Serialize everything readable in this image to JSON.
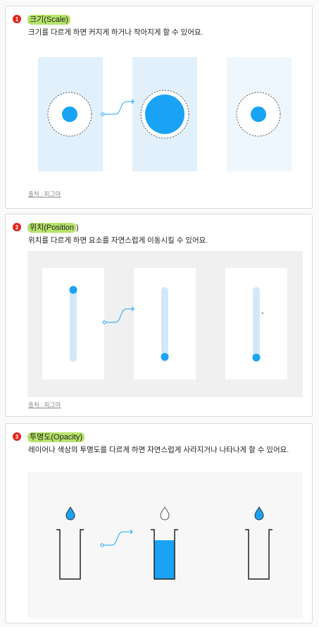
{
  "sections": [
    {
      "number": "1",
      "title_highlight": "크기(Scale)",
      "title_rest": "",
      "description": "크기를 다르게 하면 커지게 하거나 작아지게 할 수 있어요.",
      "source": "출처 : 피그마"
    },
    {
      "number": "2",
      "title_highlight": "위치(Position",
      "title_rest": ")",
      "description": "위치를 다르게 하면 요소를 자연스럽게 이동시킬 수 있어요.",
      "source": "출처 : 피그마"
    },
    {
      "number": "3",
      "title_highlight": "투명도(Opacity)",
      "title_rest": "",
      "description": "레이어나 색상의 투명도를 다르게 하면 자연스럽게 사라지거나 나타나게 할 수 있어요.",
      "source": ""
    }
  ],
  "colors": {
    "accent": "#1aa3f5",
    "highlight": "#b7e36b",
    "badge": "#e5221f",
    "panel_light": "#e1f0fb",
    "panel_lighter": "#eef7fd",
    "track": "#d3e8f7",
    "gray_bg": "#f0f0f0"
  }
}
